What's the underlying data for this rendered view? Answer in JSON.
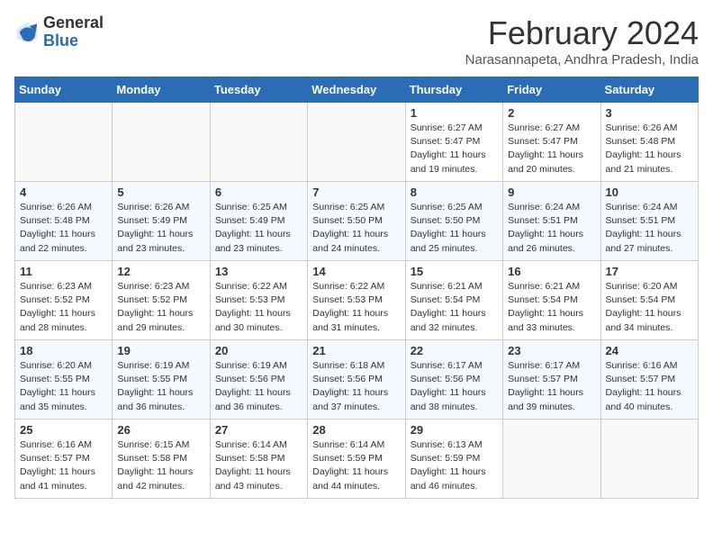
{
  "logo": {
    "general": "General",
    "blue": "Blue"
  },
  "title": "February 2024",
  "subtitle": "Narasannapeta, Andhra Pradesh, India",
  "days_of_week": [
    "Sunday",
    "Monday",
    "Tuesday",
    "Wednesday",
    "Thursday",
    "Friday",
    "Saturday"
  ],
  "weeks": [
    [
      {
        "day": "",
        "info": ""
      },
      {
        "day": "",
        "info": ""
      },
      {
        "day": "",
        "info": ""
      },
      {
        "day": "",
        "info": ""
      },
      {
        "day": "1",
        "info": "Sunrise: 6:27 AM\nSunset: 5:47 PM\nDaylight: 11 hours and 19 minutes."
      },
      {
        "day": "2",
        "info": "Sunrise: 6:27 AM\nSunset: 5:47 PM\nDaylight: 11 hours and 20 minutes."
      },
      {
        "day": "3",
        "info": "Sunrise: 6:26 AM\nSunset: 5:48 PM\nDaylight: 11 hours and 21 minutes."
      }
    ],
    [
      {
        "day": "4",
        "info": "Sunrise: 6:26 AM\nSunset: 5:48 PM\nDaylight: 11 hours and 22 minutes."
      },
      {
        "day": "5",
        "info": "Sunrise: 6:26 AM\nSunset: 5:49 PM\nDaylight: 11 hours and 23 minutes."
      },
      {
        "day": "6",
        "info": "Sunrise: 6:25 AM\nSunset: 5:49 PM\nDaylight: 11 hours and 23 minutes."
      },
      {
        "day": "7",
        "info": "Sunrise: 6:25 AM\nSunset: 5:50 PM\nDaylight: 11 hours and 24 minutes."
      },
      {
        "day": "8",
        "info": "Sunrise: 6:25 AM\nSunset: 5:50 PM\nDaylight: 11 hours and 25 minutes."
      },
      {
        "day": "9",
        "info": "Sunrise: 6:24 AM\nSunset: 5:51 PM\nDaylight: 11 hours and 26 minutes."
      },
      {
        "day": "10",
        "info": "Sunrise: 6:24 AM\nSunset: 5:51 PM\nDaylight: 11 hours and 27 minutes."
      }
    ],
    [
      {
        "day": "11",
        "info": "Sunrise: 6:23 AM\nSunset: 5:52 PM\nDaylight: 11 hours and 28 minutes."
      },
      {
        "day": "12",
        "info": "Sunrise: 6:23 AM\nSunset: 5:52 PM\nDaylight: 11 hours and 29 minutes."
      },
      {
        "day": "13",
        "info": "Sunrise: 6:22 AM\nSunset: 5:53 PM\nDaylight: 11 hours and 30 minutes."
      },
      {
        "day": "14",
        "info": "Sunrise: 6:22 AM\nSunset: 5:53 PM\nDaylight: 11 hours and 31 minutes."
      },
      {
        "day": "15",
        "info": "Sunrise: 6:21 AM\nSunset: 5:54 PM\nDaylight: 11 hours and 32 minutes."
      },
      {
        "day": "16",
        "info": "Sunrise: 6:21 AM\nSunset: 5:54 PM\nDaylight: 11 hours and 33 minutes."
      },
      {
        "day": "17",
        "info": "Sunrise: 6:20 AM\nSunset: 5:54 PM\nDaylight: 11 hours and 34 minutes."
      }
    ],
    [
      {
        "day": "18",
        "info": "Sunrise: 6:20 AM\nSunset: 5:55 PM\nDaylight: 11 hours and 35 minutes."
      },
      {
        "day": "19",
        "info": "Sunrise: 6:19 AM\nSunset: 5:55 PM\nDaylight: 11 hours and 36 minutes."
      },
      {
        "day": "20",
        "info": "Sunrise: 6:19 AM\nSunset: 5:56 PM\nDaylight: 11 hours and 36 minutes."
      },
      {
        "day": "21",
        "info": "Sunrise: 6:18 AM\nSunset: 5:56 PM\nDaylight: 11 hours and 37 minutes."
      },
      {
        "day": "22",
        "info": "Sunrise: 6:17 AM\nSunset: 5:56 PM\nDaylight: 11 hours and 38 minutes."
      },
      {
        "day": "23",
        "info": "Sunrise: 6:17 AM\nSunset: 5:57 PM\nDaylight: 11 hours and 39 minutes."
      },
      {
        "day": "24",
        "info": "Sunrise: 6:16 AM\nSunset: 5:57 PM\nDaylight: 11 hours and 40 minutes."
      }
    ],
    [
      {
        "day": "25",
        "info": "Sunrise: 6:16 AM\nSunset: 5:57 PM\nDaylight: 11 hours and 41 minutes."
      },
      {
        "day": "26",
        "info": "Sunrise: 6:15 AM\nSunset: 5:58 PM\nDaylight: 11 hours and 42 minutes."
      },
      {
        "day": "27",
        "info": "Sunrise: 6:14 AM\nSunset: 5:58 PM\nDaylight: 11 hours and 43 minutes."
      },
      {
        "day": "28",
        "info": "Sunrise: 6:14 AM\nSunset: 5:59 PM\nDaylight: 11 hours and 44 minutes."
      },
      {
        "day": "29",
        "info": "Sunrise: 6:13 AM\nSunset: 5:59 PM\nDaylight: 11 hours and 46 minutes."
      },
      {
        "day": "",
        "info": ""
      },
      {
        "day": "",
        "info": ""
      }
    ]
  ]
}
